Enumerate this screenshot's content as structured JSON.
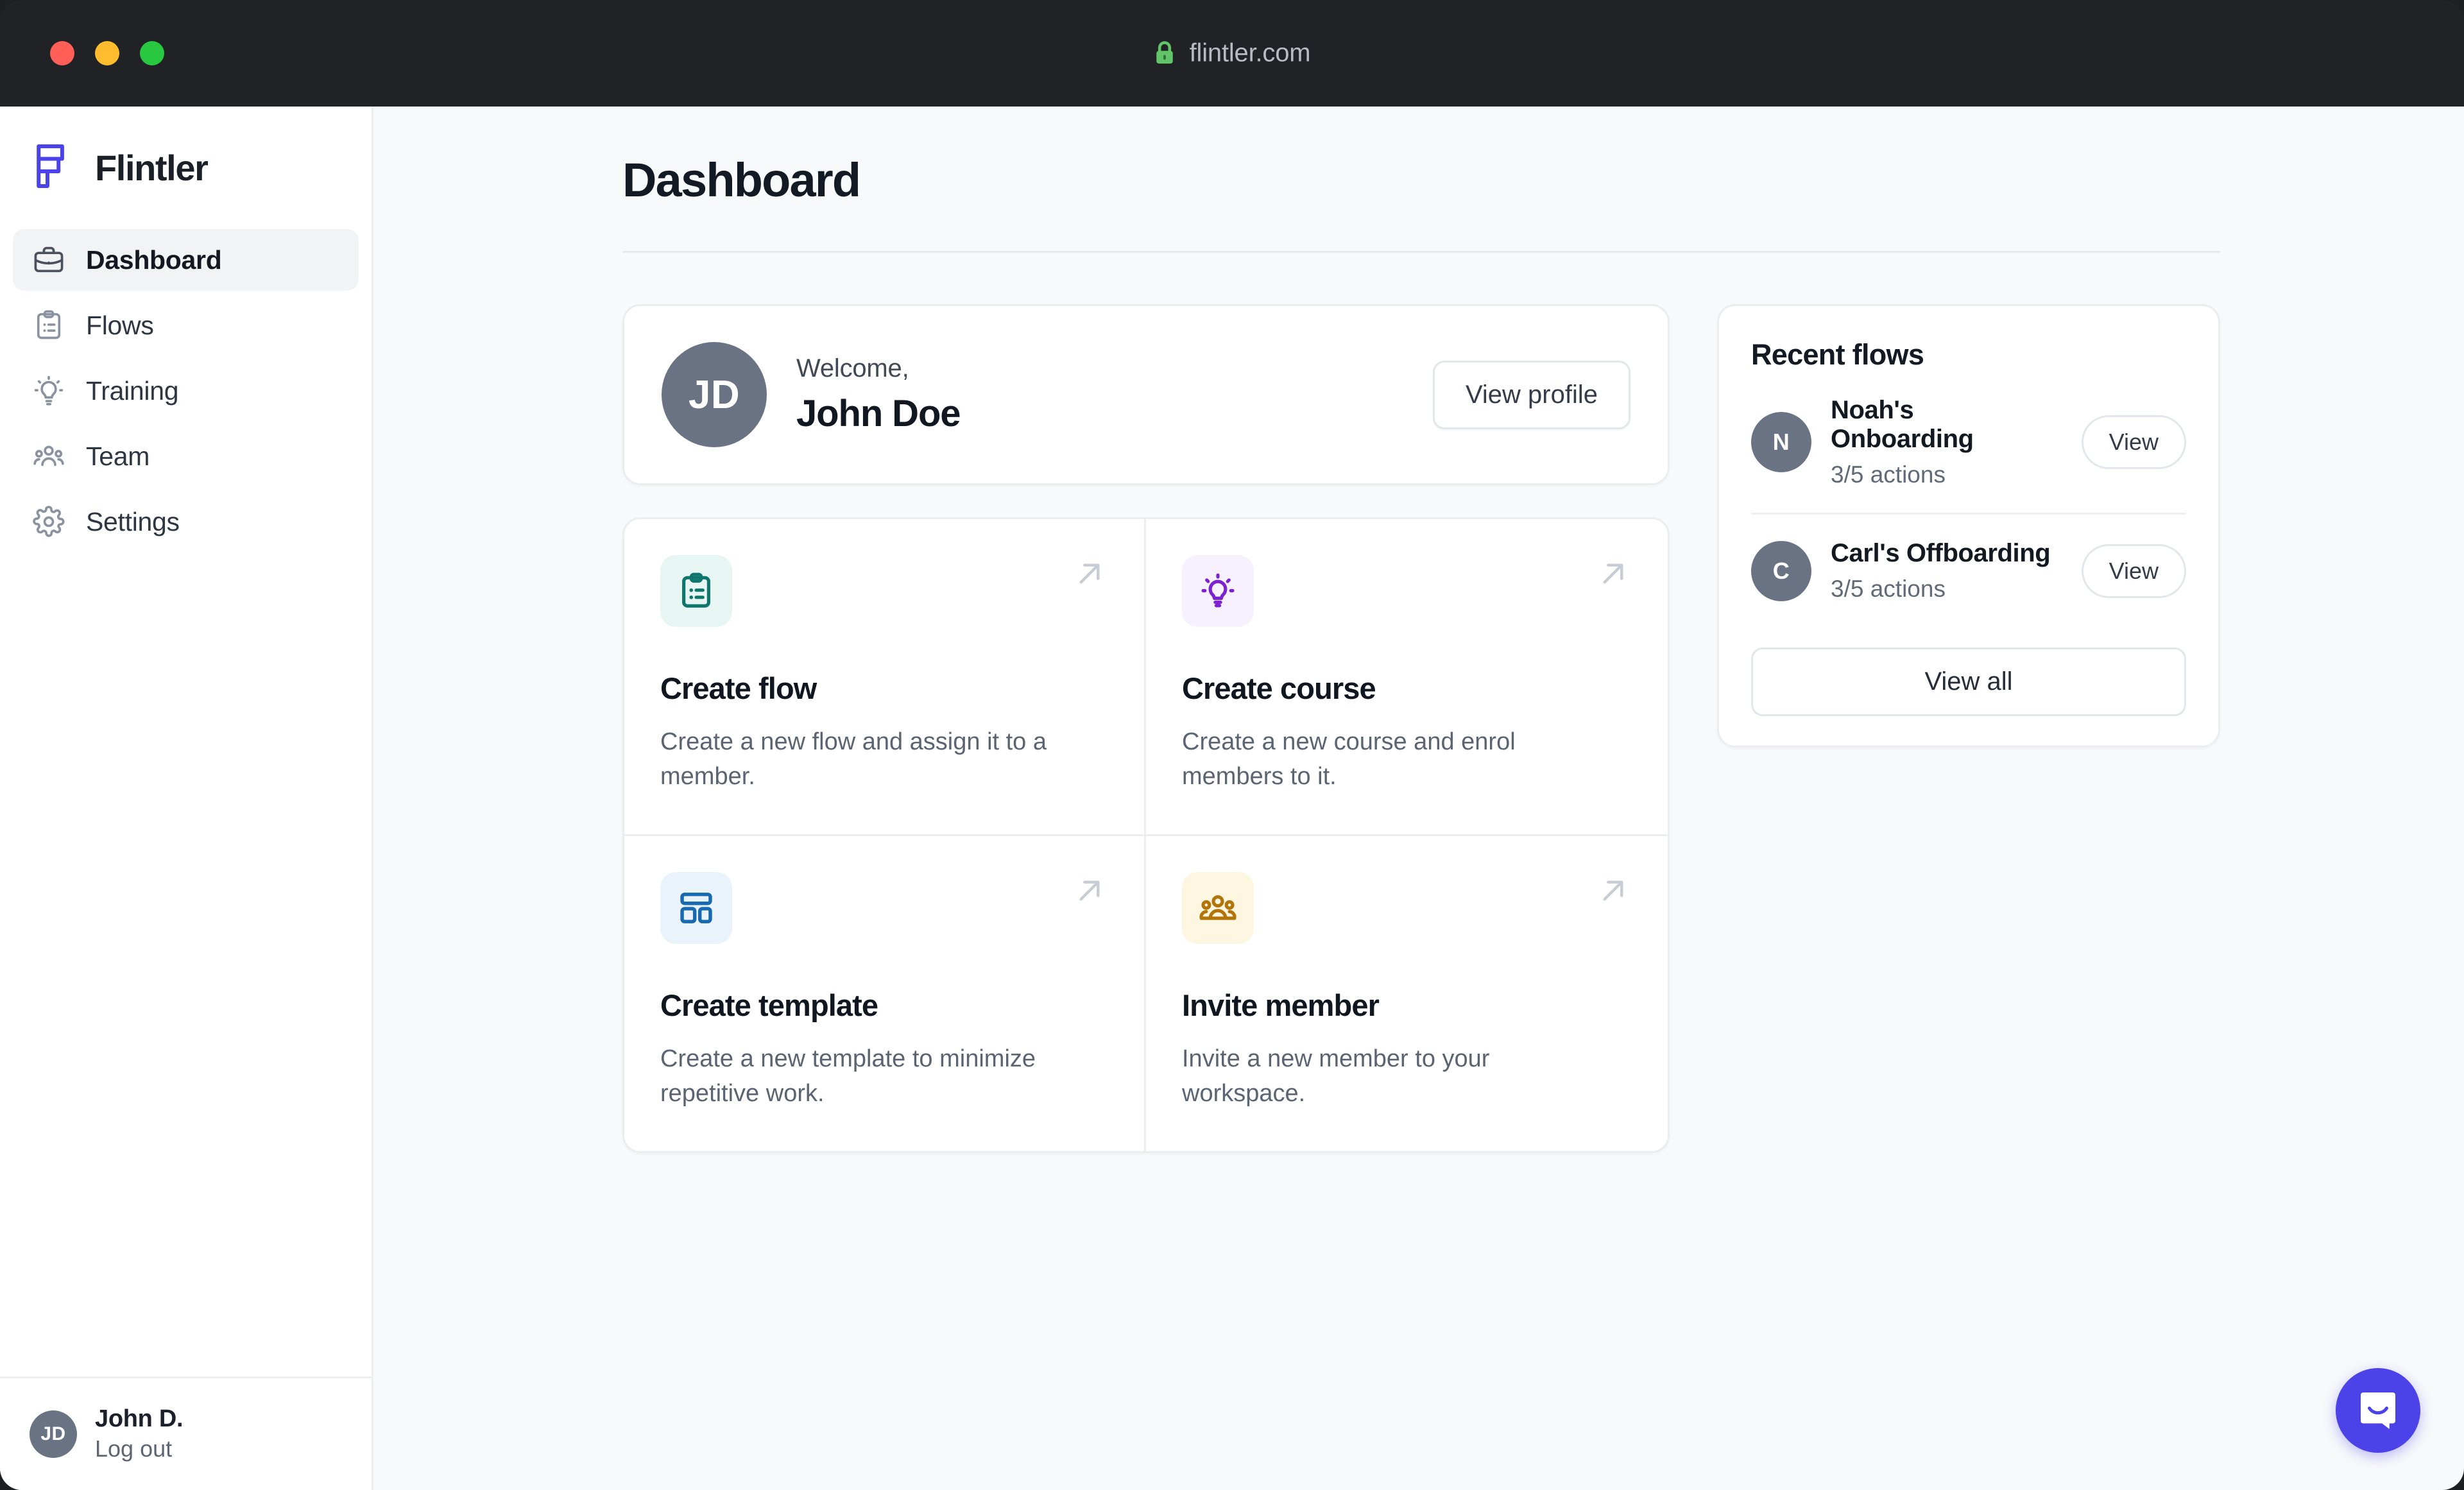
{
  "browser": {
    "url": "flintler.com",
    "lock_icon": "lock-icon",
    "traffic_lights": [
      {
        "name": "close",
        "color": "#ff5f57"
      },
      {
        "name": "minimize",
        "color": "#ffbd2e"
      },
      {
        "name": "maximize",
        "color": "#28c840"
      }
    ]
  },
  "sidebar": {
    "brand": "Flintler",
    "brand_color": "#4b42e8",
    "items": [
      {
        "label": "Dashboard",
        "icon": "briefcase-icon",
        "active": true
      },
      {
        "label": "Flows",
        "icon": "clipboard-list-icon",
        "active": false
      },
      {
        "label": "Training",
        "icon": "lightbulb-icon",
        "active": false
      },
      {
        "label": "Team",
        "icon": "users-group-icon",
        "active": false
      },
      {
        "label": "Settings",
        "icon": "gear-icon",
        "active": false
      }
    ],
    "footer": {
      "avatar_initials": "JD",
      "name": "John D.",
      "action": "Log out"
    }
  },
  "main": {
    "page_title": "Dashboard",
    "welcome": {
      "avatar_initials": "JD",
      "greeting": "Welcome,",
      "name": "John Doe",
      "button": "View profile"
    },
    "actions": [
      {
        "title": "Create flow",
        "desc": "Create a new flow and assign it to a member.",
        "icon": "clipboard-list-icon",
        "icon_color": "#0f766e",
        "icon_bg": "#e7f6f2",
        "arrow": "arrow-up-right-icon"
      },
      {
        "title": "Create course",
        "desc": "Create a new course and enrol members to it.",
        "icon": "lightbulb-icon",
        "icon_color": "#7c22ce",
        "icon_bg": "#f6f1fd",
        "arrow": "arrow-up-right-icon"
      },
      {
        "title": "Create template",
        "desc": "Create a new template to minimize repetitive work.",
        "icon": "layout-template-icon",
        "icon_color": "#1769b0",
        "icon_bg": "#eaf3fb",
        "arrow": "arrow-up-right-icon"
      },
      {
        "title": "Invite member",
        "desc": "Invite a new member to your workspace.",
        "icon": "users-group-icon",
        "icon_color": "#b27409",
        "icon_bg": "#fdf6e1",
        "arrow": "arrow-up-right-icon"
      }
    ]
  },
  "recent_flows": {
    "title": "Recent flows",
    "items": [
      {
        "initial": "N",
        "name": "Noah's Onboarding",
        "progress": "3/5 actions",
        "button": "View"
      },
      {
        "initial": "C",
        "name": "Carl's Offboarding",
        "progress": "3/5 actions",
        "button": "View"
      }
    ],
    "view_all": "View all"
  },
  "launcher": {
    "icon": "intercom-chat-icon",
    "color": "#4b42e8"
  }
}
